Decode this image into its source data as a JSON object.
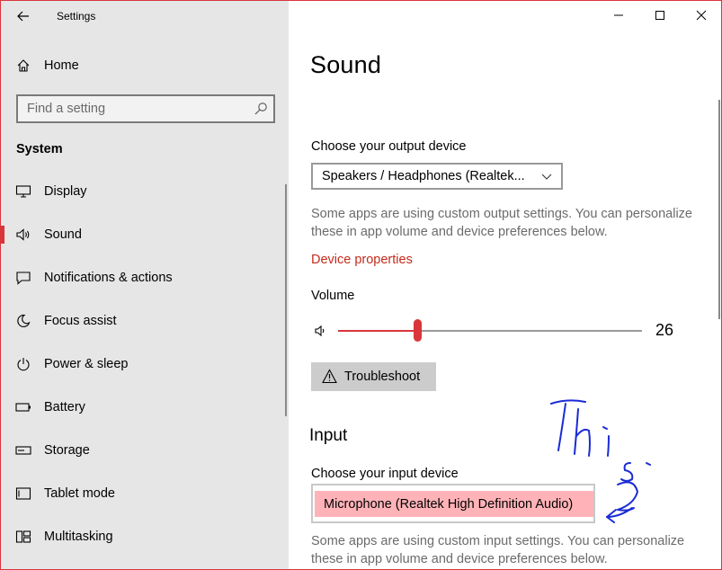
{
  "window": {
    "title": "Settings"
  },
  "sidebar": {
    "home_label": "Home",
    "search": {
      "placeholder": "Find a setting"
    },
    "section_label": "System",
    "items": [
      {
        "label": "Display",
        "icon": "display-icon",
        "active": false
      },
      {
        "label": "Sound",
        "icon": "speaker-icon",
        "active": true
      },
      {
        "label": "Notifications & actions",
        "icon": "notification-icon",
        "active": false
      },
      {
        "label": "Focus assist",
        "icon": "moon-icon",
        "active": false
      },
      {
        "label": "Power & sleep",
        "icon": "power-icon",
        "active": false
      },
      {
        "label": "Battery",
        "icon": "battery-icon",
        "active": false
      },
      {
        "label": "Storage",
        "icon": "storage-icon",
        "active": false
      },
      {
        "label": "Tablet mode",
        "icon": "tablet-icon",
        "active": false
      },
      {
        "label": "Multitasking",
        "icon": "multitasking-icon",
        "active": false
      }
    ]
  },
  "main": {
    "title": "Sound",
    "output": {
      "label": "Choose your output device",
      "selected": "Speakers / Headphones (Realtek...",
      "description": "Some apps are using custom output settings. You can personalize these in app volume and device preferences below.",
      "device_properties_link": "Device properties"
    },
    "volume": {
      "label": "Volume",
      "value": "26",
      "level": 0.26
    },
    "troubleshoot_label": "Troubleshoot",
    "input": {
      "section_title": "Input",
      "label": "Choose your input device",
      "selected": "Microphone (Realtek High Definition Audio)",
      "description": "Some apps are using custom input settings. You can personalize these in app volume and device preferences below."
    }
  },
  "colors": {
    "accent": "#d8363b",
    "link": "#c42b1c",
    "highlight": "#ffb3b8",
    "annotation_ink": "#1a2bd6",
    "sidebar_bg": "#e6e6e6"
  },
  "annotation": {
    "handwritten_text": "This 2",
    "pointer": "arrow-left"
  }
}
